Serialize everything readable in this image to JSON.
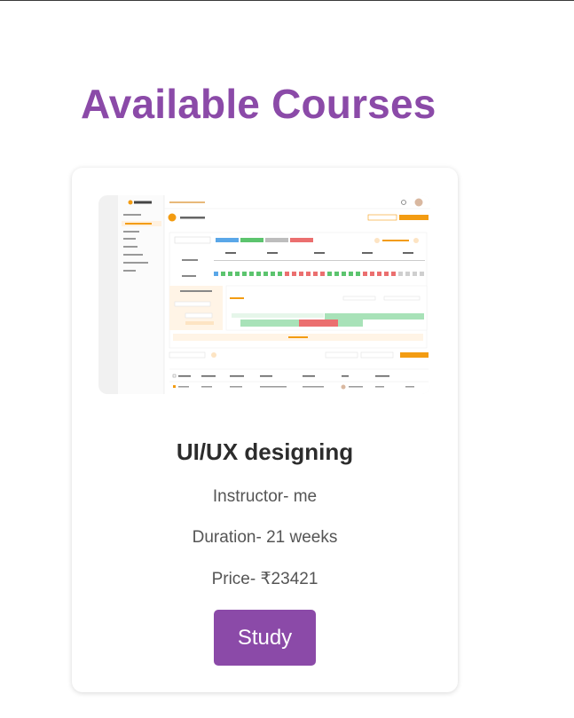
{
  "page": {
    "title": "Available Courses"
  },
  "course": {
    "title": "UI/UX designing",
    "instructor": "Instructor- me",
    "duration": "Duration- 21 weeks",
    "price": "Price- ₹23421",
    "button_label": "Study",
    "thumbnail": {
      "icon": "app-screenshot-thumbnail",
      "accent_color": "#f39c12",
      "available_color": "#6fcf97",
      "booked_color": "#eb6f6f"
    }
  }
}
